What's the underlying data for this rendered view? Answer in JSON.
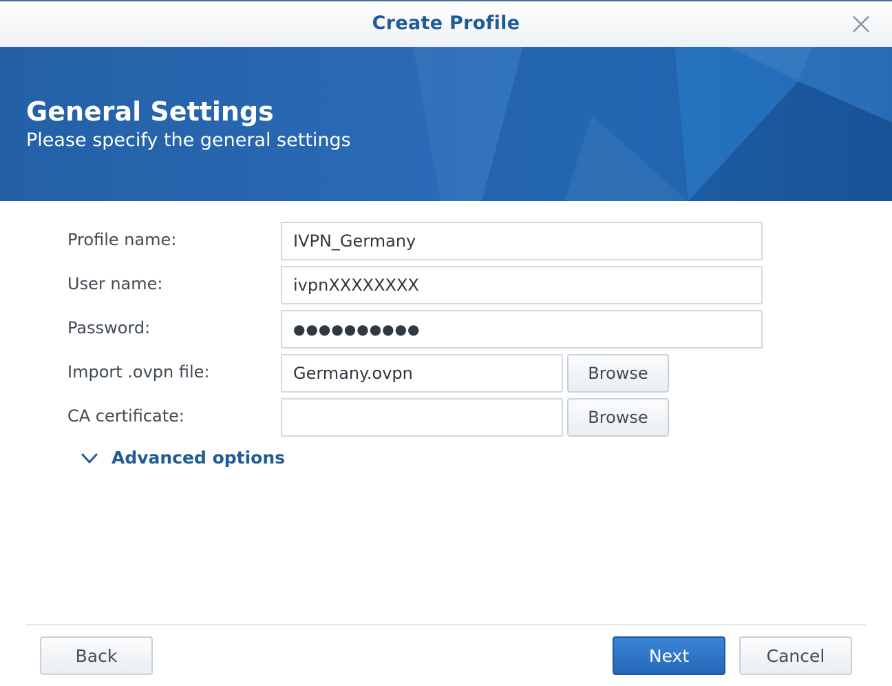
{
  "dialog": {
    "title": "Create Profile"
  },
  "banner": {
    "heading": "General Settings",
    "subheading": "Please specify the general settings"
  },
  "form": {
    "profile_name": {
      "label": "Profile name:",
      "value": "IVPN_Germany"
    },
    "user_name": {
      "label": "User name:",
      "value": "ivpnXXXXXXXX"
    },
    "password": {
      "label": "Password:",
      "masked": "●●●●●●●●●●"
    },
    "ovpn_file": {
      "label": "Import .ovpn file:",
      "value": "Germany.ovpn",
      "button": "Browse"
    },
    "ca_certificate": {
      "label": "CA certificate:",
      "value": "",
      "button": "Browse"
    },
    "advanced_options": "Advanced options"
  },
  "footer": {
    "back": "Back",
    "next": "Next",
    "cancel": "Cancel"
  },
  "colors": {
    "accent": "#1f5b94",
    "banner": "#2668b2",
    "primary_button": "#2f78c8"
  },
  "icons": {
    "close": "close-icon",
    "advanced": "chevron-down-icon"
  }
}
